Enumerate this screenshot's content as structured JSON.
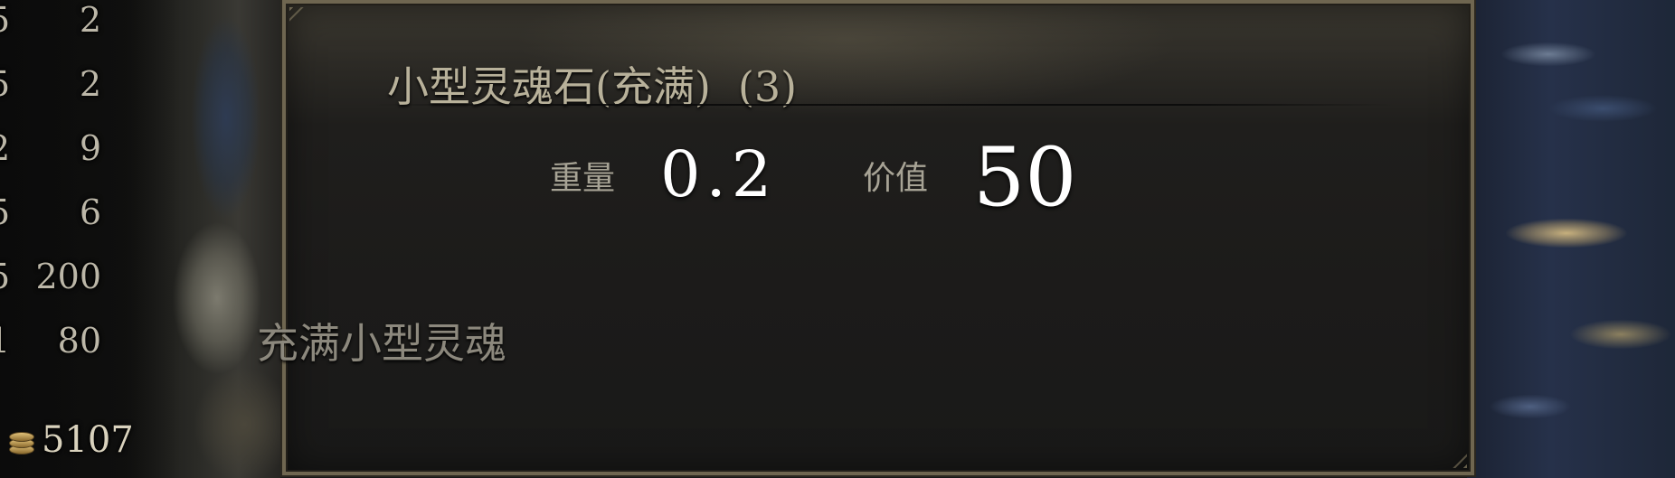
{
  "inventory": {
    "rows": [
      {
        "weight": "5",
        "value": "2"
      },
      {
        "weight": "5",
        "value": "2"
      },
      {
        "weight": "2",
        "value": "9"
      },
      {
        "weight": "5",
        "value": "6"
      },
      {
        "weight": "5",
        "value": "200"
      },
      {
        "weight": "1",
        "value": "80"
      }
    ],
    "gold": "5107",
    "gold_icon": "coin-stack-icon"
  },
  "tooltip": {
    "item_name": "小型灵魂石(充满)",
    "item_count": "(3)",
    "weight_label": "重量",
    "weight_value": "0.2",
    "value_label": "价值",
    "value_value": "50",
    "description": "充满小型灵魂"
  },
  "colors": {
    "panel_border": "#6f6650",
    "title_text": "#b8b19a",
    "stat_value_text": "#ffffff",
    "description_text": "#8c887d"
  }
}
